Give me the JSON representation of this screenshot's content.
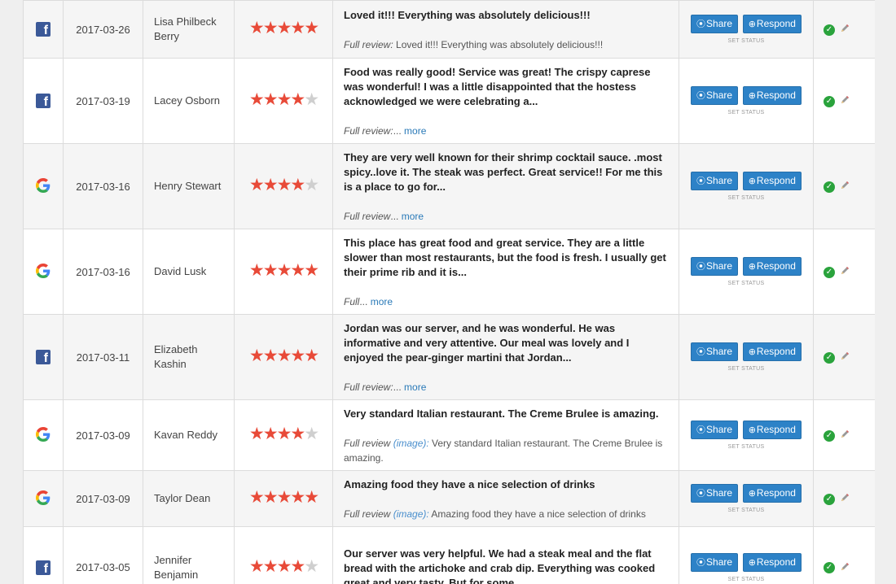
{
  "colors": {
    "accent": "#2d82c7",
    "star": "#e84a38",
    "facebook": "#3b5998",
    "ok": "#2aa33c"
  },
  "actions": {
    "share": "Share",
    "respond": "Respond",
    "set_status": "SET STATUS"
  },
  "reviews": [
    {
      "source": "facebook-icon",
      "date": "2017-03-26",
      "name": "Lisa Philbeck Berry",
      "rating": 5,
      "headline": "Loved it!!! Everything was absolutely delicious!!!",
      "full_label": "Full review:",
      "image_label": "",
      "full_text": " Loved it!!! Everything was absolutely delicious!!!",
      "more": ""
    },
    {
      "source": "facebook-icon",
      "date": "2017-03-19",
      "name": "Lacey Osborn",
      "rating": 4,
      "headline": "Food was really good! Service was great! The crispy caprese was wonderful! I was a little disappointed that the hostess acknowledged we were celebrating a...",
      "full_label": "Full review:",
      "image_label": "",
      "full_text": "...",
      "more": " more"
    },
    {
      "source": "google-icon",
      "date": "2017-03-16",
      "name": "Henry Stewart",
      "rating": 4,
      "headline": "They are very well known for their shrimp cocktail sauce. .most spicy..love it. The steak was perfect. Great service!! For me this is a place to go for...",
      "full_label": "Full review",
      "image_label": "",
      "full_text": "...",
      "more": " more"
    },
    {
      "source": "google-icon",
      "date": "2017-03-16",
      "name": "David Lusk",
      "rating": 5,
      "headline": "This place has great food and great service. They are a little slower than most restaurants, but the food is fresh. I usually get their prime rib and it is...",
      "full_label": "Full",
      "image_label": "",
      "full_text": "...",
      "more": " more"
    },
    {
      "source": "facebook-icon",
      "date": "2017-03-11",
      "name": "Elizabeth Kashin",
      "rating": 5,
      "headline": "Jordan was our server, and he was wonderful. He was informative and very attentive. Our meal was lovely and I enjoyed the pear-ginger martini that Jordan...",
      "full_label": "Full review:",
      "image_label": "",
      "full_text": "...",
      "more": " more"
    },
    {
      "source": "google-icon",
      "date": "2017-03-09",
      "name": "Kavan Reddy",
      "rating": 4,
      "headline": "Very standard Italian restaurant. The Creme Brulee is amazing.",
      "full_label": "Full review",
      "image_label": " (image):",
      "full_text": " Very standard Italian restaurant. The Creme Brulee is amazing.",
      "more": ""
    },
    {
      "source": "google-icon",
      "date": "2017-03-09",
      "name": "Taylor Dean",
      "rating": 5,
      "headline": "Amazing food they have a nice selection of drinks",
      "full_label": "Full review",
      "image_label": " (image):",
      "full_text": " Amazing food they have a nice selection of drinks",
      "more": ""
    },
    {
      "source": "facebook-icon",
      "date": "2017-03-05",
      "name": "Jennifer Benjamin",
      "rating": 4,
      "headline": "Our server was very helpful. We had a steak meal and the flat bread with the artichoke and crab dip. Everything was cooked great and very tasty. But for some...",
      "full_label": "",
      "image_label": "",
      "full_text": "",
      "more": ""
    }
  ]
}
